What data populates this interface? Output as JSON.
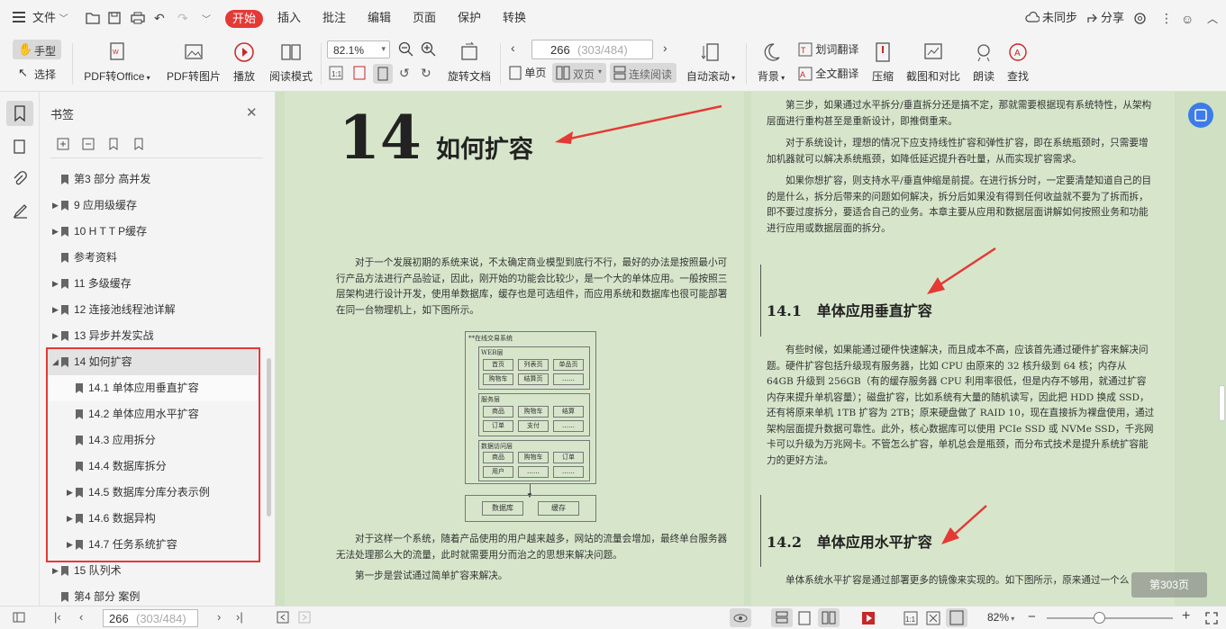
{
  "menubar": {
    "file_label": "文件",
    "tabs": [
      "开始",
      "插入",
      "批注",
      "编辑",
      "页面",
      "保护",
      "转换"
    ],
    "sync_label": "未同步",
    "share_label": "分享"
  },
  "toolbar": {
    "hand_label": "手型",
    "select_label": "选择",
    "pdf_to_office": "PDF转Office",
    "pdf_to_image": "PDF转图片",
    "play": "播放",
    "read_mode": "阅读模式",
    "zoom_value": "82.1%",
    "rotate_doc": "旋转文档",
    "page_current": "266",
    "page_info": "(303/484)",
    "single_page": "单页",
    "double_page": "双页",
    "continuous": "连续阅读",
    "auto_scroll": "自动滚动",
    "background": "背景",
    "word_translate": "划词翻译",
    "full_translate": "全文翻译",
    "compress": "压缩",
    "screenshot_compare": "截图和对比",
    "read_aloud": "朗读",
    "find": "查找"
  },
  "bookmarks": {
    "title": "书签",
    "items": [
      {
        "label": "第3 部分 高并发",
        "arrow": ""
      },
      {
        "label": "9 应用级缓存",
        "arrow": "▶"
      },
      {
        "label": "10 H T T P缓存",
        "arrow": "▶"
      },
      {
        "label": "参考资料",
        "arrow": ""
      },
      {
        "label": "11 多级缓存",
        "arrow": "▶"
      },
      {
        "label": "12 连接池线程池详解",
        "arrow": "▶"
      },
      {
        "label": "13 异步并发实战",
        "arrow": "▶"
      },
      {
        "label": "14 如何扩容",
        "arrow": "◢"
      },
      {
        "label": "14.1 单体应用垂直扩容",
        "arrow": ""
      },
      {
        "label": "14.2 单体应用水平扩容",
        "arrow": ""
      },
      {
        "label": "14.3 应用拆分",
        "arrow": ""
      },
      {
        "label": "14.4 数据库拆分",
        "arrow": ""
      },
      {
        "label": "14.5 数据库分库分表示例",
        "arrow": "▶"
      },
      {
        "label": "14.6 数据异构",
        "arrow": "▶"
      },
      {
        "label": "14.7 任务系统扩容",
        "arrow": "▶"
      },
      {
        "label": "15 队列术",
        "arrow": "▶"
      },
      {
        "label": "第4 部分 案例",
        "arrow": ""
      }
    ]
  },
  "left_page": {
    "chapter_num": "14",
    "chapter_title": "如何扩容",
    "para1": "对于一个发展初期的系统来说，不太确定商业模型到底行不行，最好的办法是按照最小可行产品方法进行产品验证，因此，刚开始的功能会比较少，是一个大的单体应用。一般按照三层架构进行设计开发，使用单数据库，缓存也是可选组件，而应用系统和数据库也很可能部署在同一台物理机上，如下图所示。",
    "diagram": {
      "title": "**在线交易系统",
      "web_layer": "WEB层",
      "web_items": [
        "首页",
        "列表页",
        "单品页",
        "购物车",
        "结算页",
        "……"
      ],
      "service_layer": "服务层",
      "service_items": [
        "商品",
        "购物车",
        "结算",
        "订单",
        "支付",
        "……"
      ],
      "data_layer": "数据访问层",
      "data_items": [
        "商品",
        "购物车",
        "订单",
        "用户",
        "……",
        "……"
      ],
      "db": "数据库",
      "cache": "缓存"
    },
    "para2": "对于这样一个系统，随着产品使用的用户越来越多，网站的流量会增加，最终单台服务器无法处理那么大的流量，此时就需要用分而治之的思想来解决问题。",
    "para3": "第一步是尝试通过简单扩容来解决。"
  },
  "right_page": {
    "para1": "第三步，如果通过水平拆分/垂直拆分还是搞不定，那就需要根据现有系统特性，从架构层面进行重构甚至是重新设计，即推倒重来。",
    "para2": "对于系统设计，理想的情况下应支持线性扩容和弹性扩容，即在系统瓶颈时，只需要增加机器就可以解决系统瓶颈，如降低延迟提升吞吐量，从而实现扩容需求。",
    "para3": "如果你想扩容，则支持水平/垂直伸缩是前提。在进行拆分时，一定要清楚知道自己的目的是什么，拆分后带来的问题如何解决，拆分后如果没有得到任何收益就不要为了拆而拆，即不要过度拆分，要适合自己的业务。本章主要从应用和数据层面讲解如何按照业务和功能进行应用或数据层面的拆分。",
    "h1_num": "14.1",
    "h1_title": "单体应用垂直扩容",
    "para4": "有些时候，如果能通过硬件快速解决，而且成本不高，应该首先通过硬件扩容来解决问题。硬件扩容包括升级现有服务器，比如 CPU 由原来的 32 核升级到 64 核；内存从 64GB 升级到 256GB（有的缓存服务器 CPU 利用率很低，但是内存不够用，就通过扩容内存来提升单机容量）；磁盘扩容，比如系统有大量的随机读写，因此把 HDD 换成 SSD，还有将原来单机 1TB 扩容为 2TB；原来硬盘做了 RAID 10，现在直接拆为裸盘使用，通过架构层面提升数据可靠性。此外，核心数据库可以使用 PCIe SSD 或 NVMe SSD，千兆网卡可以升级为万兆网卡。不管怎么扩容，单机总会是瓶颈，而分布式技术是提升系统扩容能力的更好方法。",
    "h2_num": "14.2",
    "h2_title": "单体应用水平扩容",
    "para5": "单体系统水平扩容是通过部署更多的镜像来实现的。如下图所示，原来通过一个么",
    "page_badge": "第303页"
  },
  "statusbar": {
    "page_current": "266",
    "page_info": "(303/484)",
    "zoom": "82%"
  },
  "colors": {
    "accent": "#e53935",
    "doc_bg": "#cfe0c3",
    "highlight_box": "#e53935"
  }
}
